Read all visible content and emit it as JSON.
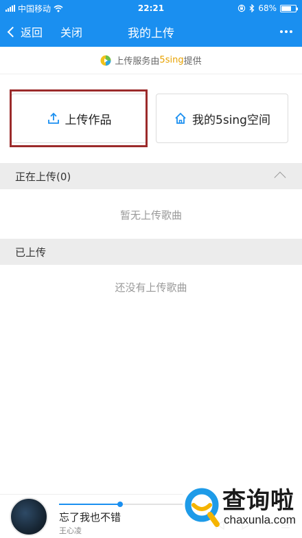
{
  "status_bar": {
    "carrier": "中国移动",
    "time": "22:21",
    "battery_percent": "68%",
    "battery_level": 0.68,
    "icons": [
      "signal-icon",
      "wifi-icon",
      "lock-rotation-icon",
      "bluetooth-icon",
      "battery-icon"
    ]
  },
  "navbar": {
    "back_label": "返回",
    "close_label": "关闭",
    "title": "我的上传",
    "more_icon": "more-icon"
  },
  "service": {
    "prefix": "上传服务由",
    "brand": "5sing",
    "suffix": "提供",
    "brand_color": "#e8a200"
  },
  "actions": {
    "upload_label": "上传作品",
    "upload_icon": "upload-icon",
    "space_label": "我的5sing空间",
    "space_icon": "home-icon"
  },
  "sections": {
    "uploading_title": "正在上传(0)",
    "uploading_empty": "暂无上传歌曲",
    "uploaded_title": "已上传",
    "uploaded_empty": "还没有上传歌曲"
  },
  "player": {
    "song_title": "忘了我也不错",
    "artist": "王心凌",
    "progress": 0.47
  },
  "watermark": {
    "cn": "查询啦",
    "en": "chaxunla.com"
  },
  "colors": {
    "primary": "#1a8ff0",
    "highlight_outline": "#9b2a2a",
    "section_bg": "#ececec"
  }
}
